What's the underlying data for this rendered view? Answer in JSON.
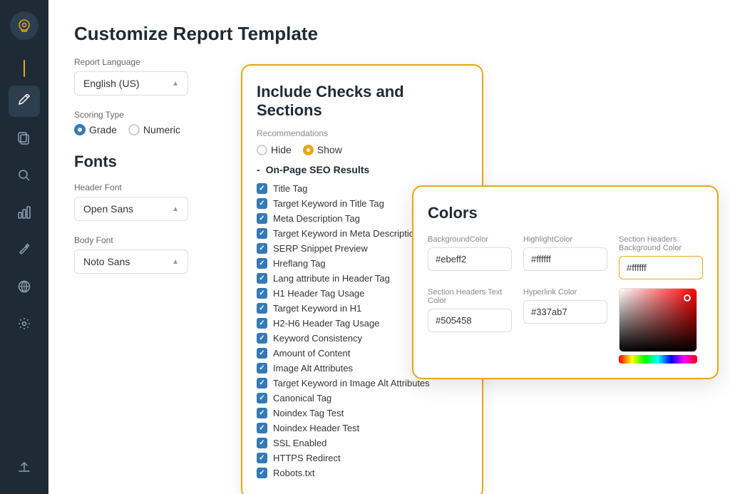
{
  "app": {
    "title": "Customize Report Template"
  },
  "sidebar": {
    "logo_icon": "⟳",
    "items": [
      {
        "id": "edit",
        "icon": "✎",
        "active": true
      },
      {
        "id": "copy",
        "icon": "⧉",
        "active": false
      },
      {
        "id": "search",
        "icon": "⌕",
        "active": false
      },
      {
        "id": "chart",
        "icon": "▦",
        "active": false
      },
      {
        "id": "tool",
        "icon": "⚒",
        "active": false
      },
      {
        "id": "globe",
        "icon": "⊕",
        "active": false
      },
      {
        "id": "settings",
        "icon": "⚙",
        "active": false
      },
      {
        "id": "upload",
        "icon": "⬆",
        "active": false
      }
    ]
  },
  "report_language": {
    "label": "Report Language",
    "value": "English (US)"
  },
  "scoring_type": {
    "label": "Scoring Type",
    "options": [
      {
        "label": "Grade",
        "selected": true
      },
      {
        "label": "Numeric",
        "selected": false
      }
    ]
  },
  "fonts": {
    "title": "Fonts",
    "header_font": {
      "label": "Header Font",
      "value": "Open Sans"
    },
    "body_font": {
      "label": "Body Font",
      "value": "Noto Sans"
    }
  },
  "checks_panel": {
    "title": "Include Checks and Sections",
    "recommendations_label": "Recommendations",
    "hide_label": "Hide",
    "show_label": "Show",
    "section": "On-Page SEO Results",
    "items": [
      "Title Tag",
      "Target Keyword in Title Tag",
      "Meta Description Tag",
      "Target Keyword in Meta Description",
      "SERP Snippet Preview",
      "Hreflang Tag",
      "Lang attribute in Header Tag",
      "H1 Header Tag Usage",
      "Target Keyword in H1",
      "H2-H6 Header Tag Usage",
      "Keyword Consistency",
      "Amount of Content",
      "Image Alt Attributes",
      "Target Keyword in Image Alt Attributes",
      "Canonical Tag",
      "Noindex Tag Test",
      "Noindex Header Test",
      "SSL Enabled",
      "HTTPS Redirect",
      "Robots.txt"
    ]
  },
  "colors_panel": {
    "title": "Colors",
    "background_color": {
      "label": "BackgroundColor",
      "value": "#ebeff2"
    },
    "highlight_color": {
      "label": "HighlightColor",
      "value": "#ffffff"
    },
    "section_headers_bg_color": {
      "label": "Section Headers Background Color",
      "value": "#ffffff"
    },
    "section_headers_text_color": {
      "label": "Section Headers Text Color",
      "value": "#505458"
    },
    "hyperlink_color": {
      "label": "Hyperlink Color",
      "value": "#337ab7"
    }
  }
}
